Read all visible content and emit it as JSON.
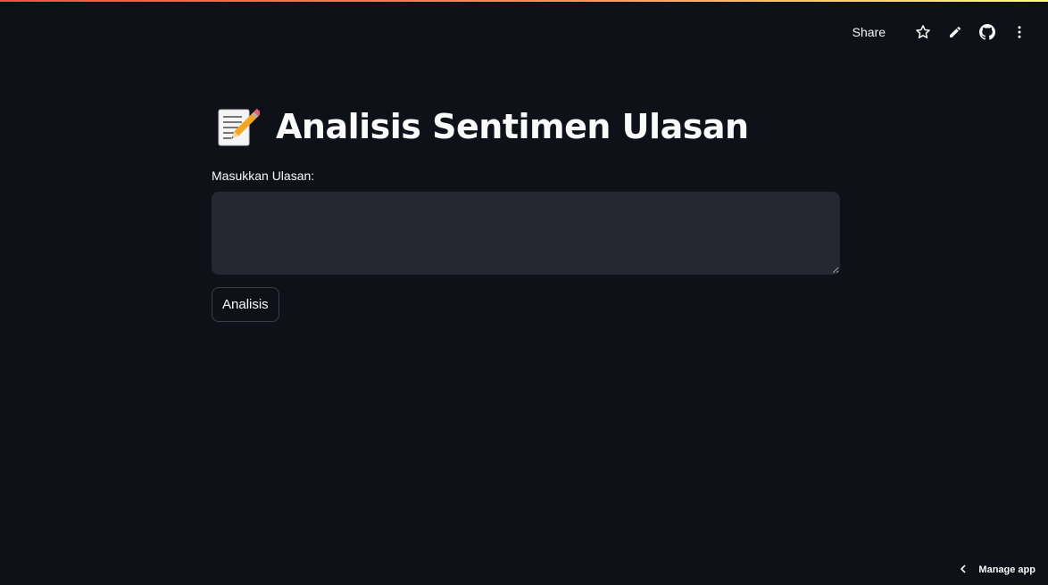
{
  "toolbar": {
    "share_label": "Share",
    "icons": [
      "star-icon",
      "pencil-icon",
      "github-icon",
      "more-vertical-icon"
    ]
  },
  "main": {
    "title_icon": "memo-icon",
    "title": "Analisis Sentimen Ulasan",
    "review_label": "Masukkan Ulasan:",
    "review_value": "",
    "submit_label": "Analisis"
  },
  "footer": {
    "manage_app_label": "Manage app",
    "manage_app_icon": "chevron-left-icon"
  },
  "colors": {
    "background": "#0e1117",
    "input_background": "#262730",
    "text": "#fafafa",
    "accent_gradient": [
      "#ff4b4b",
      "#fffd80"
    ]
  }
}
